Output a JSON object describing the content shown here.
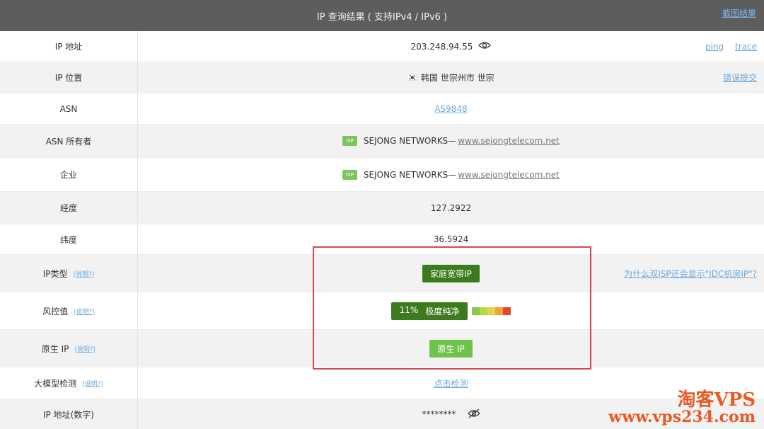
{
  "header": {
    "title": "IP 查询结果 ( 支持IPv4 / IPv6 )",
    "screenshot_link": "截图结果"
  },
  "rows": {
    "ip": {
      "label": "IP 地址",
      "value": "203.248.94.55",
      "ping": "ping",
      "trace": "trace"
    },
    "location": {
      "label": "IP 位置",
      "flag": "🇰🇷",
      "value": "韩国 世宗州市 世宗",
      "report": "错误提交"
    },
    "asn": {
      "label": "ASN",
      "value": "AS9848"
    },
    "asn_owner": {
      "label": "ASN 所有者",
      "badge": "ISP",
      "name": "SEJONG NETWORKS—",
      "site": "www.sejongtelecom.net"
    },
    "company": {
      "label": "企业",
      "badge": "ISP",
      "name": "SEJONG NETWORKS—",
      "site": "www.sejongtelecom.net"
    },
    "longitude": {
      "label": "经度",
      "value": "127.2922"
    },
    "latitude": {
      "label": "纬度",
      "value": "36.5924"
    },
    "ip_type": {
      "label": "IP类型",
      "hint": "(说明?)",
      "value": "家庭宽带IP",
      "why": "为什么双ISP还会显示\"IDC机房IP\"?"
    },
    "risk": {
      "label": "风控值",
      "hint": "(说明?)",
      "percent": "11%",
      "level": "极度纯净",
      "bar_colors": [
        "#8ac849",
        "#b8d84a",
        "#e6d44d",
        "#f0a33a",
        "#e24a2a"
      ]
    },
    "native": {
      "label": "原生 IP",
      "hint": "(说明?)",
      "value": "原生 IP"
    },
    "llm": {
      "label": "大模型检测",
      "hint": "(说明?)",
      "value": "点击检测"
    },
    "ip_numeric": {
      "label": "IP 地址(数字)",
      "value": "********"
    }
  },
  "watermark": {
    "line1": "淘客VPS",
    "line2": "www.vps234.com"
  }
}
